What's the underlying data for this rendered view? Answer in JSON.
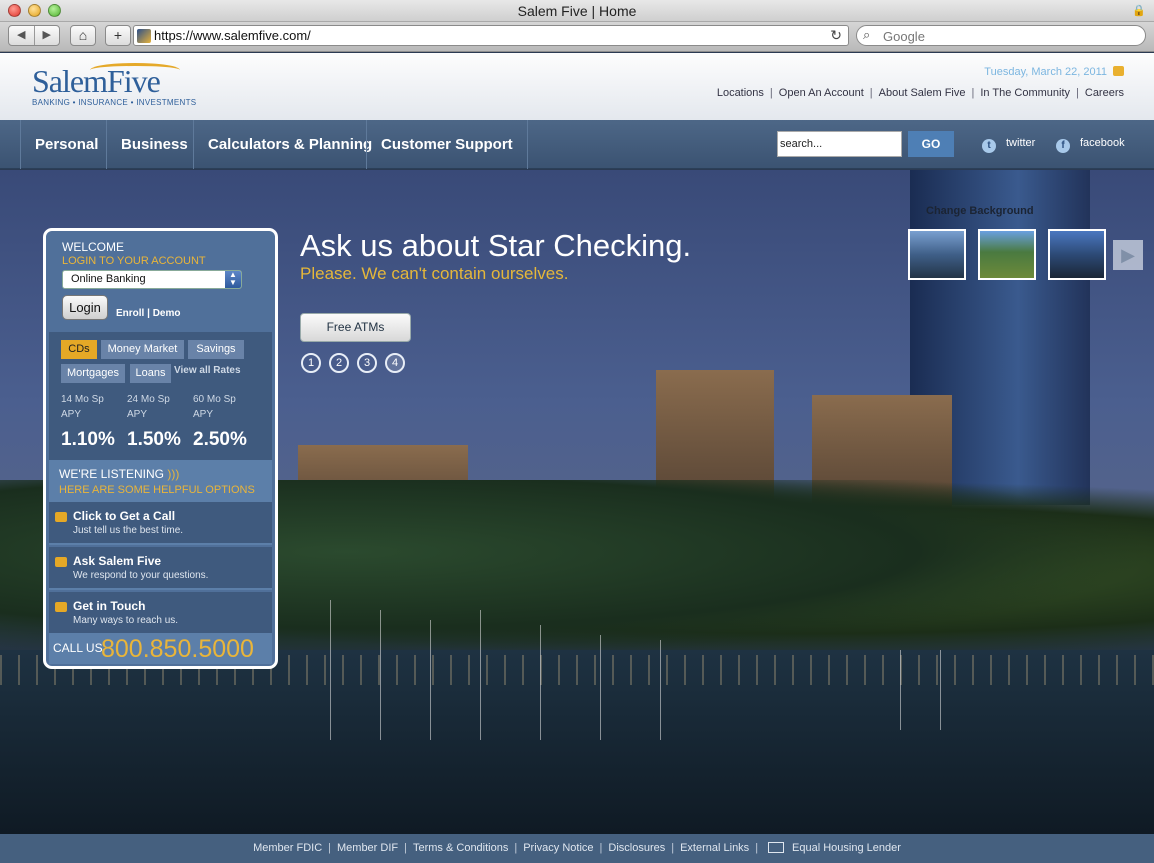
{
  "browser": {
    "window_title": "Salem Five | Home",
    "url": "https://www.salemfive.com/",
    "search_placeholder": "Google",
    "back": "◀",
    "forward": "▶",
    "home": "⌂",
    "add": "+",
    "reload": "↻",
    "search_icon": "⌕"
  },
  "header": {
    "logo_text": "SalemFive",
    "logo_tagline": "BANKING • INSURANCE • INVESTMENTS",
    "date": "Tuesday, March 22, 2011",
    "links": [
      "Locations",
      "Open An Account",
      "About Salem Five",
      "In The Community",
      "Careers"
    ],
    "separator": "|"
  },
  "nav": {
    "items": [
      "Personal",
      "Business",
      "Calculators & Planning",
      "Customer Support"
    ],
    "search_placeholder": "search...",
    "go_label": "GO",
    "twitter_label": "twitter",
    "facebook_label": "facebook"
  },
  "hero": {
    "headline": "Ask us about Star Checking.",
    "subhead": "Please. We can't contain ourselves.",
    "cta_label": "Free ATMs",
    "slides": [
      "1",
      "2",
      "3",
      "4"
    ],
    "active_slide": 4,
    "background_label": "Change Background",
    "next_arrow": "▶"
  },
  "panel": {
    "welcome": "WELCOME",
    "login_label": "LOGIN TO YOUR ACCOUNT",
    "select_value": "Online Banking",
    "login_button": "Login",
    "enroll_demo": "Enroll | Demo",
    "rate_tabs": [
      "CDs",
      "Money Market",
      "Savings",
      "Mortgages",
      "Loans"
    ],
    "selected_tab": "CDs",
    "view_all": "View all Rates",
    "rates": [
      {
        "term": "14 Mo Sp",
        "type": "APY",
        "value": "1.10%"
      },
      {
        "term": "24 Mo Sp",
        "type": "APY",
        "value": "1.50%"
      },
      {
        "term": "60 Mo Sp",
        "type": "APY",
        "value": "2.50%"
      }
    ],
    "listening_title": "WE'RE LISTENING",
    "listening_sub": "HERE ARE SOME HELPFUL OPTIONS",
    "options": [
      {
        "title": "Click to Get a Call",
        "sub": "Just tell us the best time."
      },
      {
        "title": "Ask Salem Five",
        "sub": "We respond to your questions."
      },
      {
        "title": "Get in Touch",
        "sub": "Many ways to reach us."
      }
    ],
    "call_label": "CALL US",
    "phone": "800.850.5000"
  },
  "footer": {
    "links": [
      "Member FDIC",
      "Member DIF",
      "Terms & Conditions",
      "Privacy Notice",
      "Disclosures",
      "External Links"
    ],
    "equal_housing": "Equal Housing Lender",
    "separator": "|"
  },
  "colors": {
    "brand_blue": "#2e5f9a",
    "accent_gold": "#e9b53a",
    "nav_bg": "#45607f"
  }
}
